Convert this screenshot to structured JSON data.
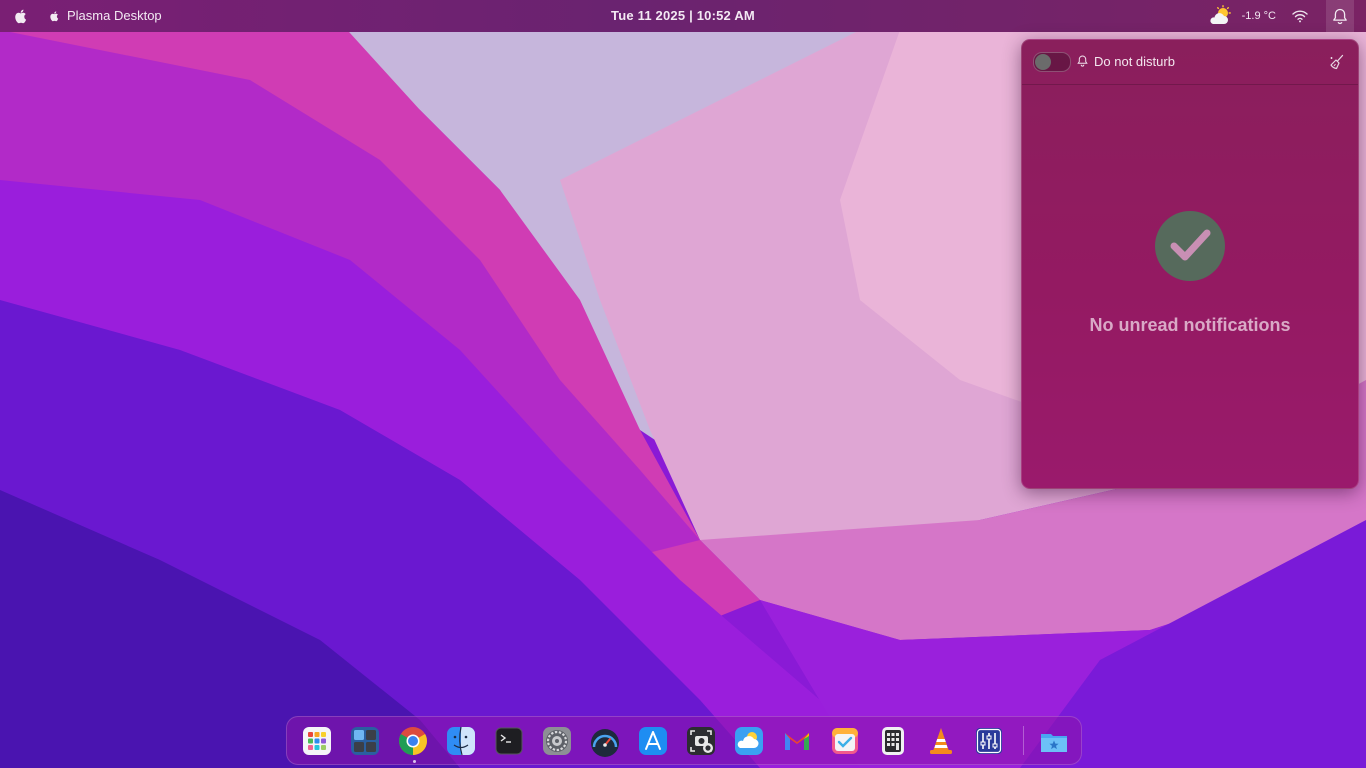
{
  "topbar": {
    "app_name": "Plasma Desktop",
    "clock": "Tue 11 2025 | 10:52 AM",
    "temperature": "-1.9 °C"
  },
  "notifications": {
    "dnd_label": "Do not disturb",
    "dnd_enabled": false,
    "empty_message": "No unread notifications"
  },
  "dock": {
    "items": [
      "launchpad",
      "window-manager",
      "chrome",
      "finder",
      "terminal",
      "system-settings",
      "system-monitor",
      "app-store",
      "screenshot",
      "weather",
      "gmail",
      "tasks",
      "calculator",
      "vlc",
      "mixer",
      "favorites-folder"
    ],
    "running": [
      "chrome"
    ]
  },
  "colors": {
    "topbar": "#6a2370",
    "popup": "#941a62",
    "check_circle": "#5a6a5e",
    "check_mark": "#c98fb4"
  }
}
